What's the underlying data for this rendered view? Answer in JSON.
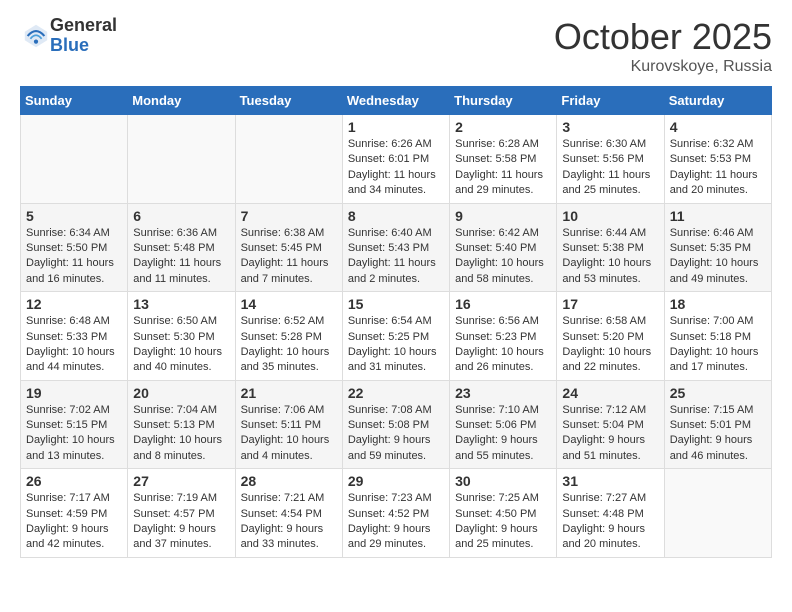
{
  "header": {
    "logo_general": "General",
    "logo_blue": "Blue",
    "month_title": "October 2025",
    "location": "Kurovskoye, Russia"
  },
  "days_of_week": [
    "Sunday",
    "Monday",
    "Tuesday",
    "Wednesday",
    "Thursday",
    "Friday",
    "Saturday"
  ],
  "weeks": [
    [
      {
        "day": "",
        "info": ""
      },
      {
        "day": "",
        "info": ""
      },
      {
        "day": "",
        "info": ""
      },
      {
        "day": "1",
        "info": "Sunrise: 6:26 AM\nSunset: 6:01 PM\nDaylight: 11 hours and 34 minutes."
      },
      {
        "day": "2",
        "info": "Sunrise: 6:28 AM\nSunset: 5:58 PM\nDaylight: 11 hours and 29 minutes."
      },
      {
        "day": "3",
        "info": "Sunrise: 6:30 AM\nSunset: 5:56 PM\nDaylight: 11 hours and 25 minutes."
      },
      {
        "day": "4",
        "info": "Sunrise: 6:32 AM\nSunset: 5:53 PM\nDaylight: 11 hours and 20 minutes."
      }
    ],
    [
      {
        "day": "5",
        "info": "Sunrise: 6:34 AM\nSunset: 5:50 PM\nDaylight: 11 hours and 16 minutes."
      },
      {
        "day": "6",
        "info": "Sunrise: 6:36 AM\nSunset: 5:48 PM\nDaylight: 11 hours and 11 minutes."
      },
      {
        "day": "7",
        "info": "Sunrise: 6:38 AM\nSunset: 5:45 PM\nDaylight: 11 hours and 7 minutes."
      },
      {
        "day": "8",
        "info": "Sunrise: 6:40 AM\nSunset: 5:43 PM\nDaylight: 11 hours and 2 minutes."
      },
      {
        "day": "9",
        "info": "Sunrise: 6:42 AM\nSunset: 5:40 PM\nDaylight: 10 hours and 58 minutes."
      },
      {
        "day": "10",
        "info": "Sunrise: 6:44 AM\nSunset: 5:38 PM\nDaylight: 10 hours and 53 minutes."
      },
      {
        "day": "11",
        "info": "Sunrise: 6:46 AM\nSunset: 5:35 PM\nDaylight: 10 hours and 49 minutes."
      }
    ],
    [
      {
        "day": "12",
        "info": "Sunrise: 6:48 AM\nSunset: 5:33 PM\nDaylight: 10 hours and 44 minutes."
      },
      {
        "day": "13",
        "info": "Sunrise: 6:50 AM\nSunset: 5:30 PM\nDaylight: 10 hours and 40 minutes."
      },
      {
        "day": "14",
        "info": "Sunrise: 6:52 AM\nSunset: 5:28 PM\nDaylight: 10 hours and 35 minutes."
      },
      {
        "day": "15",
        "info": "Sunrise: 6:54 AM\nSunset: 5:25 PM\nDaylight: 10 hours and 31 minutes."
      },
      {
        "day": "16",
        "info": "Sunrise: 6:56 AM\nSunset: 5:23 PM\nDaylight: 10 hours and 26 minutes."
      },
      {
        "day": "17",
        "info": "Sunrise: 6:58 AM\nSunset: 5:20 PM\nDaylight: 10 hours and 22 minutes."
      },
      {
        "day": "18",
        "info": "Sunrise: 7:00 AM\nSunset: 5:18 PM\nDaylight: 10 hours and 17 minutes."
      }
    ],
    [
      {
        "day": "19",
        "info": "Sunrise: 7:02 AM\nSunset: 5:15 PM\nDaylight: 10 hours and 13 minutes."
      },
      {
        "day": "20",
        "info": "Sunrise: 7:04 AM\nSunset: 5:13 PM\nDaylight: 10 hours and 8 minutes."
      },
      {
        "day": "21",
        "info": "Sunrise: 7:06 AM\nSunset: 5:11 PM\nDaylight: 10 hours and 4 minutes."
      },
      {
        "day": "22",
        "info": "Sunrise: 7:08 AM\nSunset: 5:08 PM\nDaylight: 9 hours and 59 minutes."
      },
      {
        "day": "23",
        "info": "Sunrise: 7:10 AM\nSunset: 5:06 PM\nDaylight: 9 hours and 55 minutes."
      },
      {
        "day": "24",
        "info": "Sunrise: 7:12 AM\nSunset: 5:04 PM\nDaylight: 9 hours and 51 minutes."
      },
      {
        "day": "25",
        "info": "Sunrise: 7:15 AM\nSunset: 5:01 PM\nDaylight: 9 hours and 46 minutes."
      }
    ],
    [
      {
        "day": "26",
        "info": "Sunrise: 7:17 AM\nSunset: 4:59 PM\nDaylight: 9 hours and 42 minutes."
      },
      {
        "day": "27",
        "info": "Sunrise: 7:19 AM\nSunset: 4:57 PM\nDaylight: 9 hours and 37 minutes."
      },
      {
        "day": "28",
        "info": "Sunrise: 7:21 AM\nSunset: 4:54 PM\nDaylight: 9 hours and 33 minutes."
      },
      {
        "day": "29",
        "info": "Sunrise: 7:23 AM\nSunset: 4:52 PM\nDaylight: 9 hours and 29 minutes."
      },
      {
        "day": "30",
        "info": "Sunrise: 7:25 AM\nSunset: 4:50 PM\nDaylight: 9 hours and 25 minutes."
      },
      {
        "day": "31",
        "info": "Sunrise: 7:27 AM\nSunset: 4:48 PM\nDaylight: 9 hours and 20 minutes."
      },
      {
        "day": "",
        "info": ""
      }
    ]
  ]
}
